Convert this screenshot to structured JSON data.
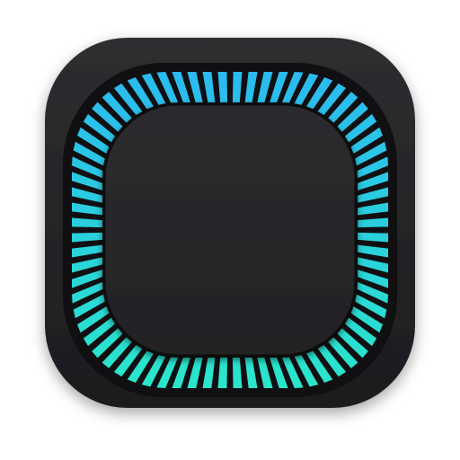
{
  "icon": {
    "name": "app-icon",
    "colors": {
      "outer_tile_top": "#2e2e30",
      "outer_tile_bottom": "#1c1c1e",
      "track": "#101012",
      "inner_tile_top": "#2c2c2e",
      "inner_tile_bottom": "#222224",
      "segment_top": "#2bb8f2",
      "segment_bottom": "#2ae8c8"
    },
    "segment_count": 72
  }
}
